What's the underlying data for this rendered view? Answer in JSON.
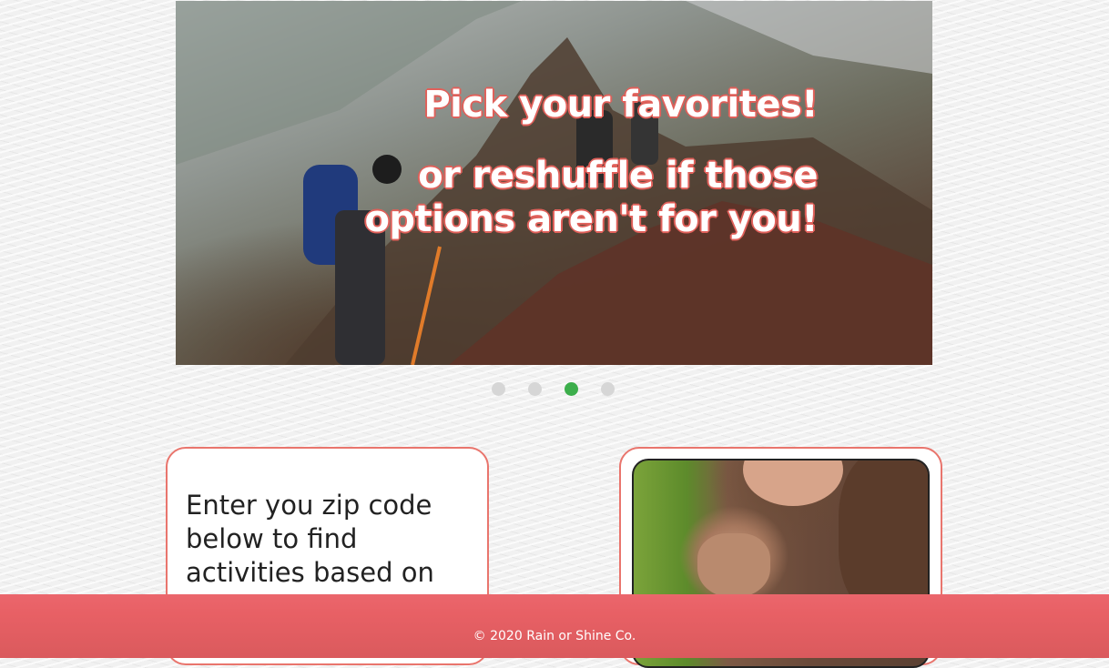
{
  "hero": {
    "headline": "Pick your favorites!",
    "subline": "or reshuffle if those options aren't for you!"
  },
  "carousel": {
    "slide_count": 4,
    "active_index": 2,
    "active_color": "#3cae4b",
    "inactive_color": "#d6d6d6"
  },
  "zip_card": {
    "text": "Enter you zip code below to find activities based on"
  },
  "activity_card": {
    "image": "pottery-photo"
  },
  "footer": {
    "copyright": "© 2020 Rain or Shine Co."
  },
  "colors": {
    "accent": "#e9756d",
    "footer": "#e86065"
  }
}
